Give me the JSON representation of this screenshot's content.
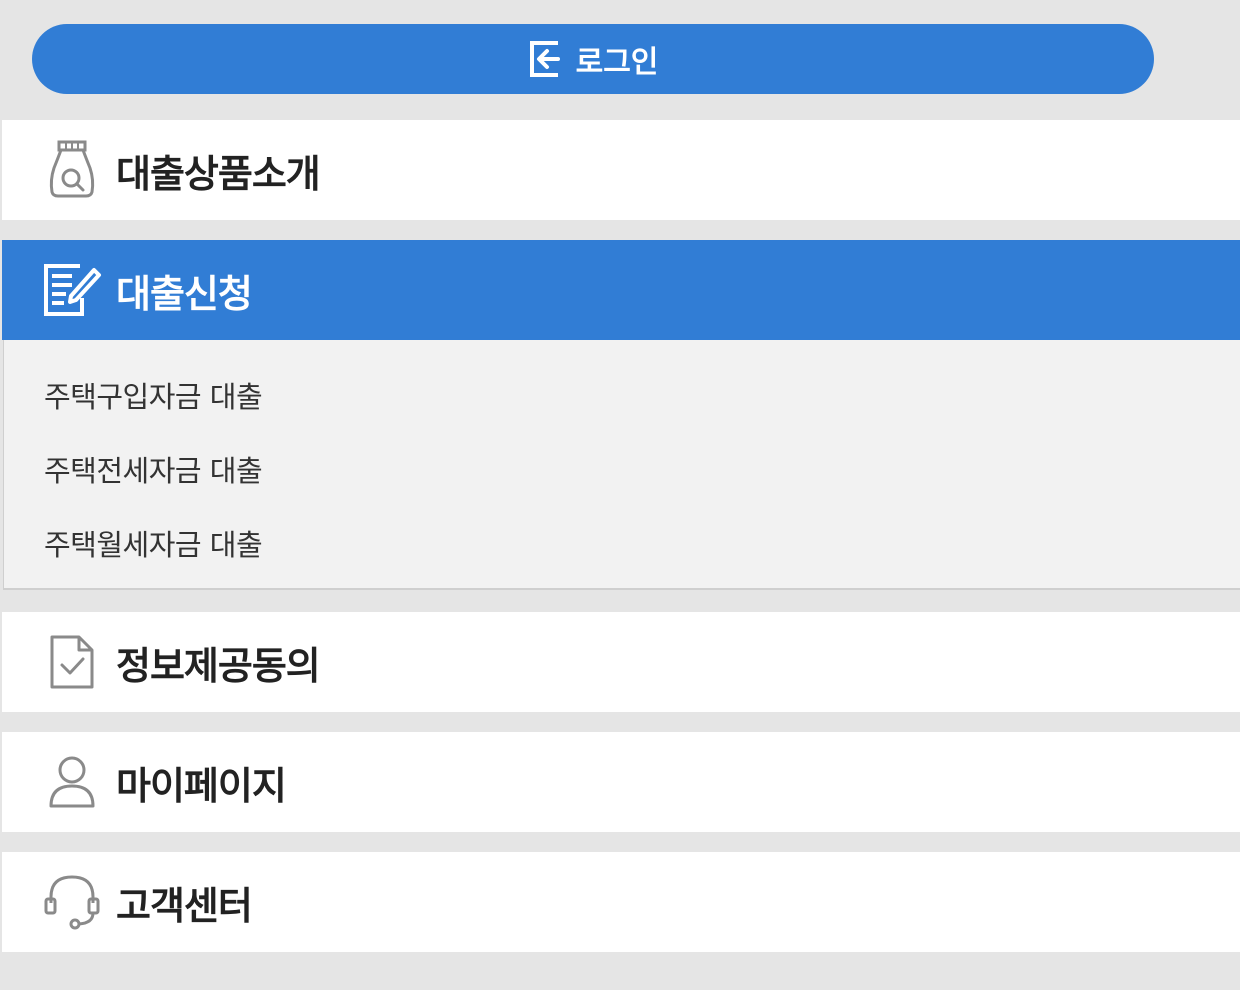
{
  "login": {
    "label": "로그인",
    "icon": "login-icon"
  },
  "menu": [
    {
      "label": "대출상품소개",
      "icon": "money-bag-search-icon",
      "active": false
    },
    {
      "label": "대출신청",
      "icon": "document-pen-icon",
      "active": true,
      "submenu": [
        "주택구입자금 대출",
        "주택전세자금 대출",
        "주택월세자금 대출"
      ]
    },
    {
      "label": "정보제공동의",
      "icon": "document-check-icon",
      "active": false
    },
    {
      "label": "마이페이지",
      "icon": "user-icon",
      "active": false
    },
    {
      "label": "고객센터",
      "icon": "headset-icon",
      "active": false
    }
  ],
  "colors": {
    "accent": "#317dd5",
    "background": "#e5e5e5",
    "submenu_bg": "#f2f2f2",
    "icon_gray": "#8a8a8a"
  }
}
